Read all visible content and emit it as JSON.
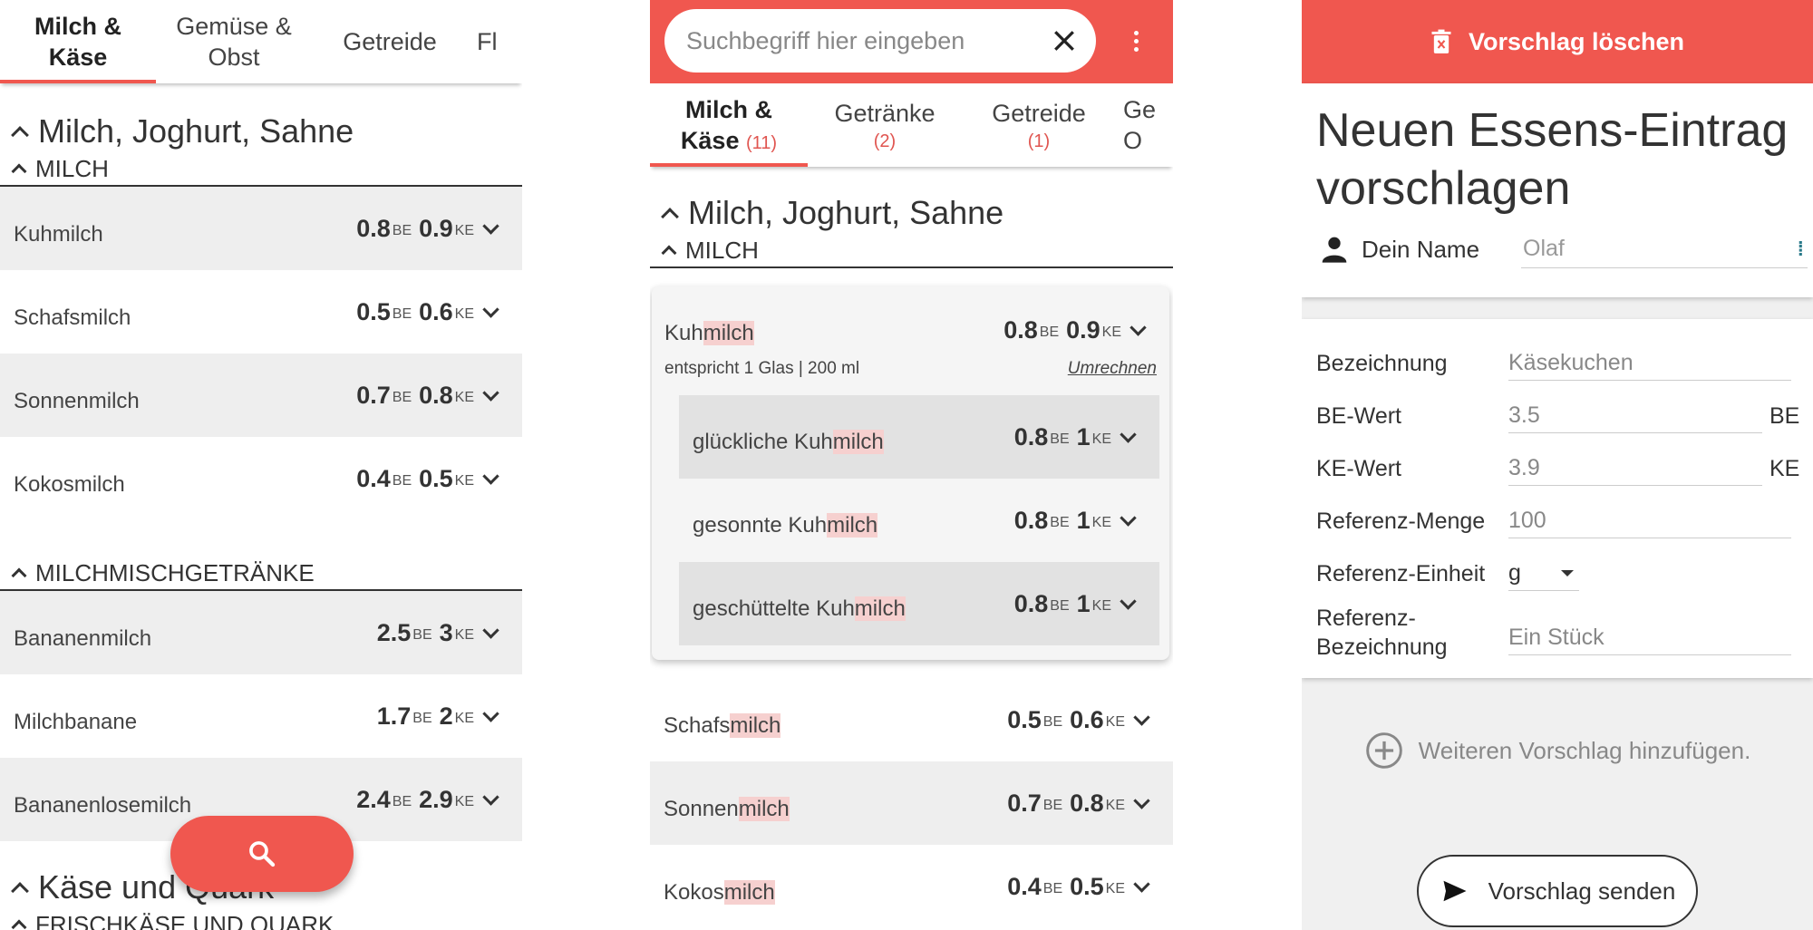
{
  "panel1": {
    "tabs": [
      {
        "label": "Milch &\nKäse"
      },
      {
        "label": "Gemüse &\nObst"
      },
      {
        "label": "Getreide"
      },
      {
        "label": "Fl"
      }
    ],
    "section1": {
      "title": "Milch, Joghurt, Sahne",
      "sub1": "MILCH",
      "items1": [
        {
          "name": "Kuhmilch",
          "be": "0.8",
          "ke": "0.9"
        },
        {
          "name": "Schafsmilch",
          "be": "0.5",
          "ke": "0.6"
        },
        {
          "name": "Sonnenmilch",
          "be": "0.7",
          "ke": "0.8"
        },
        {
          "name": "Kokosmilch",
          "be": "0.4",
          "ke": "0.5"
        }
      ],
      "sub2": "MILCHMISCHGETRÄNKE",
      "items2": [
        {
          "name": "Bananenmilch",
          "be": "2.5",
          "ke": "3"
        },
        {
          "name": "Milchbanane",
          "be": "1.7",
          "ke": "2"
        },
        {
          "name": "Bananenlosemilch",
          "be": "2.4",
          "ke": "2.9"
        }
      ]
    },
    "section2": {
      "title": "Käse und Quark",
      "sub1": "FRISCHKÄSE UND QUARK"
    },
    "be_unit": "BE",
    "ke_unit": "KE"
  },
  "panel2": {
    "search_placeholder": "Suchbegriff hier eingeben",
    "tabs": [
      {
        "label": "Milch &\nKäse",
        "count": "(11)"
      },
      {
        "label": "Getränke",
        "count": "(2)"
      },
      {
        "label": "Getreide",
        "count": "(1)"
      },
      {
        "label": "Ge\nO",
        "count": ""
      }
    ],
    "section_title": "Milch, Joghurt, Sahne",
    "sub": "MILCH",
    "card": {
      "name_pre": "Kuh",
      "name_hl": "milch",
      "be": "0.8",
      "ke": "0.9",
      "desc": "entspricht 1 Glas | 200 ml",
      "convert": "Umrechnen",
      "variants": [
        {
          "pre": "glückliche Kuh",
          "hl": "milch",
          "be": "0.8",
          "ke": "1"
        },
        {
          "pre": "gesonnte Kuh",
          "hl": "milch",
          "be": "0.8",
          "ke": "1"
        },
        {
          "pre": "geschüttelte Kuh",
          "hl": "milch",
          "be": "0.8",
          "ke": "1"
        }
      ]
    },
    "rows": [
      {
        "pre": "Schafs",
        "hl": "milch",
        "be": "0.5",
        "ke": "0.6"
      },
      {
        "pre": "Sonnen",
        "hl": "milch",
        "be": "0.7",
        "ke": "0.8"
      },
      {
        "pre": "Kokos",
        "hl": "milch",
        "be": "0.4",
        "ke": "0.5"
      }
    ]
  },
  "panel3": {
    "delete_label": "Vorschlag löschen",
    "heading": "Neuen Essens-Eintrag vorschlagen",
    "name_label": "Dein Name",
    "name_value": "Olaf",
    "fields": [
      {
        "label": "Bezeichnung",
        "value": "Käsekuchen",
        "unit": ""
      },
      {
        "label": "BE-Wert",
        "value": "3.5",
        "unit": "BE"
      },
      {
        "label": "KE-Wert",
        "value": "3.9",
        "unit": "KE"
      },
      {
        "label": "Referenz-Menge",
        "value": "100",
        "unit": ""
      },
      {
        "label": "Referenz-Einheit",
        "value": "g",
        "unit": ""
      },
      {
        "label": "Referenz-\nBezeichnung",
        "value": "Ein Stück",
        "unit": ""
      }
    ],
    "add_label": "Weiteren Vorschlag hinzufügen.",
    "send_label": "Vorschlag senden"
  },
  "colors": {
    "accent": "#f0574f",
    "highlight": "#f6d0cf"
  }
}
